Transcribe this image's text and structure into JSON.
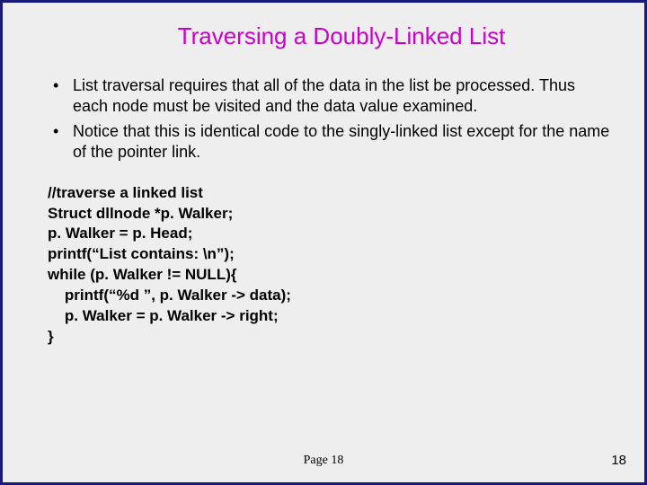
{
  "title": "Traversing a Doubly-Linked List",
  "bullets": [
    "List traversal requires that all of the data in the list be processed. Thus each node must be visited and the data value examined.",
    "Notice that this is identical code to the singly-linked list except for the name of the pointer link."
  ],
  "code": "//traverse a linked list\nStruct dllnode *p. Walker;\np. Walker = p. Head;\nprintf(“List contains: \\n”);\nwhile (p. Walker != NULL){\n    printf(“%d ”, p. Walker -> data);\n    p. Walker = p. Walker -> right;\n}",
  "pageCenter": "Page 18",
  "pageRight": "18"
}
